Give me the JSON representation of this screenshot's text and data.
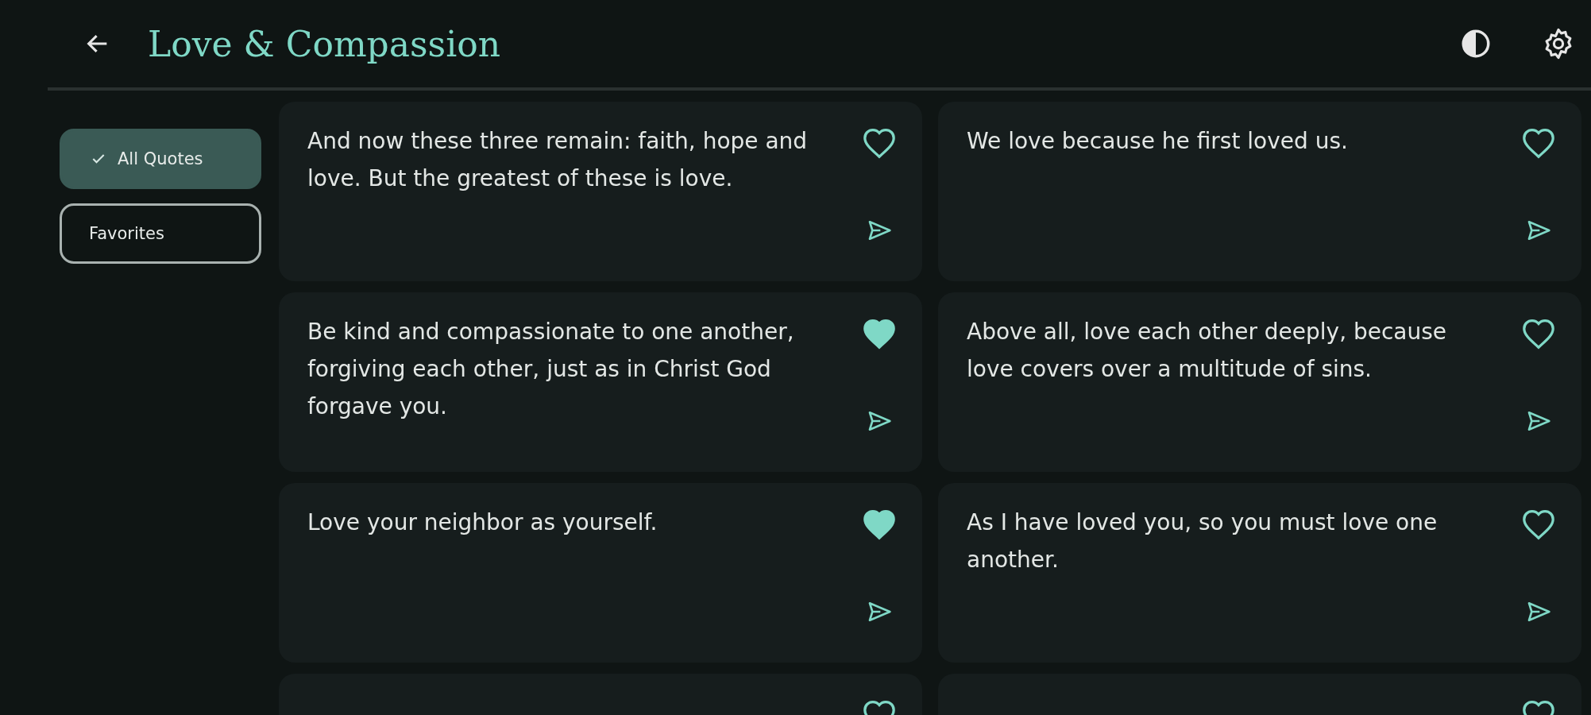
{
  "header": {
    "title": "Love & Compassion"
  },
  "filters": [
    {
      "label": "All Quotes",
      "selected": true
    },
    {
      "label": "Favorites",
      "selected": false
    }
  ],
  "quotes": [
    {
      "text": "And now these three remain: faith, hope and love. But the greatest of these is love.",
      "favorite": false
    },
    {
      "text": "We love because he first loved us.",
      "favorite": false
    },
    {
      "text": "Be kind and compassionate to one another, forgiving each other, just as in Christ God forgave you.",
      "favorite": true
    },
    {
      "text": "Above all, love each other deeply, because love covers over a multitude of sins.",
      "favorite": false
    },
    {
      "text": "Love your neighbor as yourself.",
      "favorite": true
    },
    {
      "text": "As I have loved you, so you must love one another.",
      "favorite": false
    },
    {
      "favorite": false
    },
    {
      "favorite": false
    }
  ]
}
